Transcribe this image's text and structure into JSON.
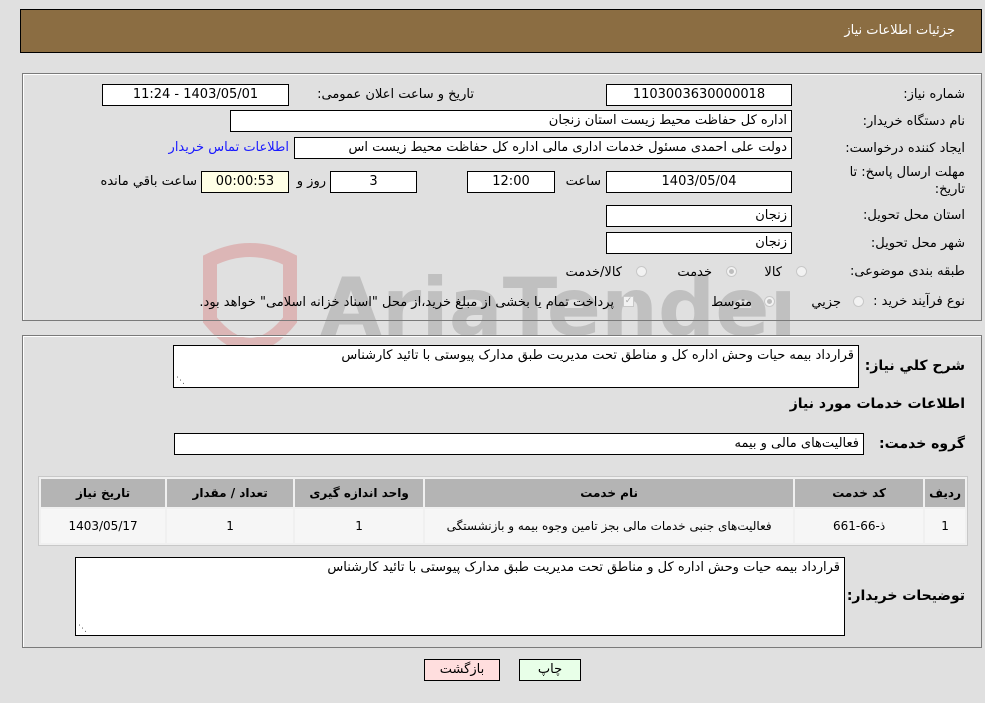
{
  "header": {
    "title": "جزئیات اطلاعات نیاز"
  },
  "details": {
    "need_number": {
      "label": "شماره نیاز:",
      "value": "1103003630000018"
    },
    "announce_datetime": {
      "label": "تاریخ و ساعت اعلان عمومی:",
      "value": "1403/05/01 - 11:24"
    },
    "buyer_org": {
      "label": "نام دستگاه خریدار:",
      "value": "اداره کل حفاظت محیط زیست استان زنجان"
    },
    "requester": {
      "label": "ایجاد کننده درخواست:",
      "value": "دولت علی احمدی مسئول خدمات اداری مالی اداره کل حفاظت محیط زیست اس",
      "contact_link": "اطلاعات تماس خریدار"
    },
    "deadline": {
      "label": "مهلت ارسال پاسخ: تا تاریخ:",
      "date": "1403/05/04",
      "time_label": "ساعت",
      "time": "12:00",
      "days": "3",
      "days_label": "روز و",
      "remaining": "00:00:53",
      "remaining_label": "ساعت باقي مانده"
    },
    "province": {
      "label": "استان محل تحویل:",
      "value": "زنجان"
    },
    "city": {
      "label": "شهر محل تحویل:",
      "value": "زنجان"
    },
    "category": {
      "label": "طبقه بندی موضوعی:",
      "options": [
        "کالا",
        "خدمت",
        "کالا/خدمت"
      ],
      "selected": "خدمت"
    },
    "purchase_type": {
      "label": "نوع فرآیند خرید :",
      "options": [
        "جزيي",
        "متوسط"
      ],
      "selected": "متوسط",
      "treasury_note": "پرداخت تمام یا بخشی از مبلغ خرید،از محل \"اسناد خزانه اسلامی\" خواهد بود."
    }
  },
  "summary": {
    "label": "شرح کلي نياز:",
    "value": "قرارداد بیمه حیات وحش اداره کل و مناطق تحت مدیریت طبق مدارک پیوستی با تائید کارشناس"
  },
  "services_heading": "اطلاعات خدمات مورد نياز",
  "service_group": {
    "label": "گروه خدمت:",
    "value": "فعالیت‌های مالی و بیمه"
  },
  "table": {
    "headers": [
      "رديف",
      "کد خدمت",
      "نام خدمت",
      "واحد اندازه گیری",
      "تعداد / مقدار",
      "تاريخ نياز"
    ],
    "rows": [
      [
        "1",
        "ذ-66-661",
        "فعالیت‌های جنبی خدمات مالی بجز تامین وجوه بیمه و بازنشستگی",
        "1",
        "1",
        "1403/05/17"
      ]
    ]
  },
  "buyer_notes": {
    "label": "توضیحات خریدار:",
    "value": "قرارداد بیمه حیات وحش اداره کل و مناطق تحت مدیریت طبق مدارک پیوستی با تائید کارشناس"
  },
  "buttons": {
    "back": "بازگشت",
    "print": "چاپ"
  },
  "watermark": {
    "text": "AriaTender.neT"
  },
  "colors": {
    "header_bg": "#8b6d42",
    "back_btn": "#ffdede",
    "print_btn": "#e8ffe8",
    "link": "#1a1aff"
  }
}
